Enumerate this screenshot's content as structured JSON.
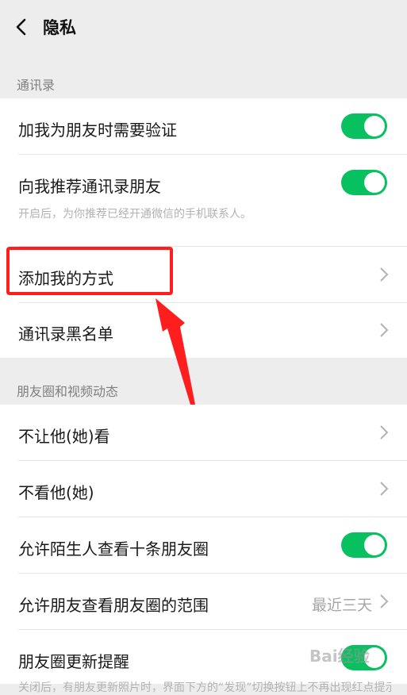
{
  "header": {
    "title": "隐私"
  },
  "sections": {
    "contacts": {
      "title": "通讯录",
      "verify_label": "加我为朋友时需要验证",
      "recommend_label": "向我推荐通讯录朋友",
      "recommend_hint": "开启后，为你推荐已经开通微信的手机联系人。",
      "add_methods_label": "添加我的方式",
      "blacklist_label": "通讯录黑名单"
    },
    "moments": {
      "title": "朋友圈和视频动态",
      "hide_from_label": "不让他(她)看",
      "dont_see_label": "不看他(她)",
      "stranger_view_label": "允许陌生人查看十条朋友圈",
      "view_range_label": "允许朋友查看朋友圈的范围",
      "view_range_value": "最近三天",
      "update_reminder_label": "朋友圈更新提醒",
      "update_reminder_hint": "关闭后，有朋友更新照片时，界面下方的“发现”切换按钮上不再出现红点提示。"
    }
  },
  "toggles": {
    "verify": true,
    "recommend": true,
    "stranger_view": true,
    "update_reminder": true
  },
  "watermark": "Bai经验",
  "colors": {
    "toggle_on": "#07c160",
    "highlight": "#ff1e1e",
    "background": "#ededed"
  }
}
